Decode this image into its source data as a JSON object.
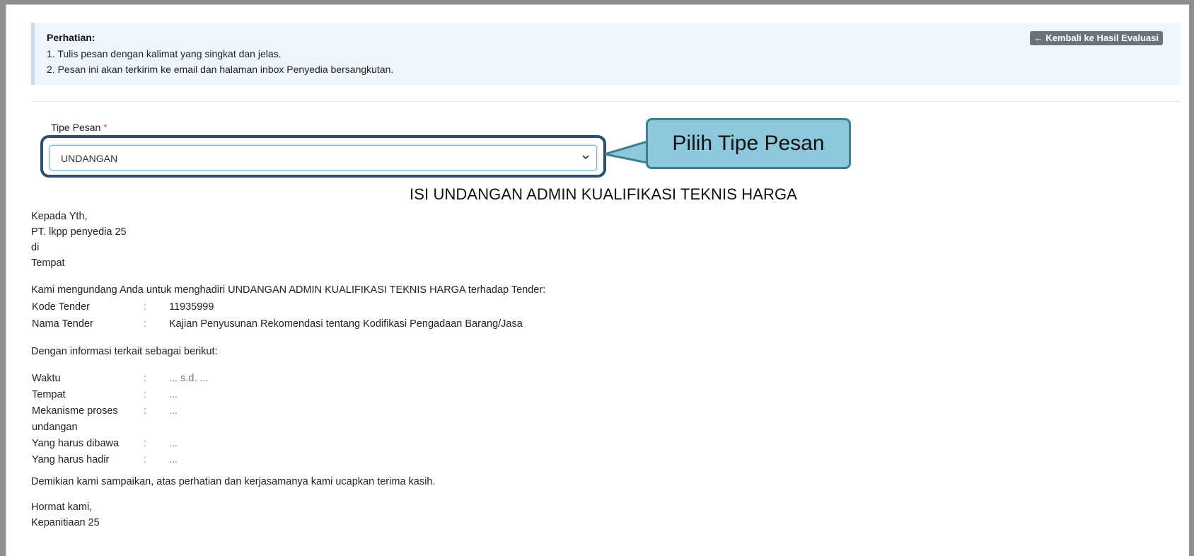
{
  "notice": {
    "title": "Perhatian:",
    "line1": "1. Tulis pesan dengan kalimat yang singkat dan jelas.",
    "line2": "2. Pesan ini akan terkirim ke email dan halaman inbox Penyedia bersangkutan."
  },
  "back_button": {
    "icon": "arrow-left-icon",
    "label": "← Kembali ke Hasil Evaluasi"
  },
  "form": {
    "tipe_label": "Tipe Pesan",
    "required_mark": "*",
    "tipe_value": "UNDANGAN"
  },
  "callout": {
    "label": "Pilih Tipe Pesan"
  },
  "letter": {
    "heading": "ISI UNDANGAN ADMIN KUALIFIKASI TEKNIS HARGA",
    "recipient": [
      "Kepada Yth,",
      "PT. lkpp penyedia 25",
      "di",
      "Tempat"
    ],
    "intro": "Kami mengundang Anda untuk menghadiri UNDANGAN ADMIN KUALIFIKASI TEKNIS HARGA terhadap Tender:",
    "kode_label": "Kode Tender",
    "kode_value": "11935999",
    "nama_label": "Nama Tender",
    "nama_value": "Kajian Penyusunan Rekomendasi tentang Kodifikasi Pengadaan Barang/Jasa",
    "info_intro": "Dengan informasi terkait sebagai berikut:",
    "separator": ":",
    "waktu_label": "Waktu",
    "waktu_value": "... s.d. ...",
    "tempat_label": "Tempat",
    "tempat_value": "...",
    "mekanisme_label_1": "Mekanisme proses",
    "mekanisme_label_2": "undangan",
    "mekanisme_value": "...",
    "dibawa_label": "Yang harus dibawa",
    "dibawa_value": "...",
    "hadir_label": "Yang harus hadir",
    "hadir_value": "...",
    "closing": "Demikian kami sampaikan, atas perhatian dan kerjasamanya kami ucapkan terima kasih.",
    "regards": "Hormat kami,",
    "signer": "Kepanitiaan 25"
  }
}
